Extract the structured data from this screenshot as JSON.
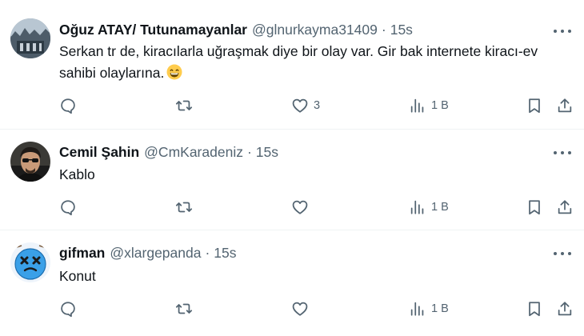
{
  "tweets": [
    {
      "name": "Oğuz ATAY/ Tutunamayanlar",
      "handle": "@glnurkayma31409",
      "time": "15s",
      "text": "Serkan tr de, kiracılarla uğraşmak diye bir olay var. Gir bak internete kiracı-ev sahibi olaylarına.",
      "emoji": "grinning-face-with-smiling-eyes",
      "reply_count": "",
      "retweet_count": "",
      "like_count": "3",
      "views": "1 B"
    },
    {
      "name": "Cemil Şahin",
      "handle": "@CmKaradeniz",
      "time": "15s",
      "text": "Kablo",
      "reply_count": "",
      "retweet_count": "",
      "like_count": "",
      "views": "1 B"
    },
    {
      "name": "gifman",
      "handle": "@xlargepanda",
      "time": "15s",
      "text": "Konut",
      "reply_count": "",
      "retweet_count": "",
      "like_count": "",
      "views": "1 B"
    }
  ],
  "icons": {
    "reply": "reply-icon",
    "retweet": "retweet-icon",
    "like": "heart-icon",
    "views": "views-icon",
    "bookmark": "bookmark-icon",
    "share": "share-icon",
    "more": "more-icon"
  },
  "colors": {
    "name": "#0f1419",
    "secondary": "#536471",
    "divider": "#eff3f4"
  }
}
